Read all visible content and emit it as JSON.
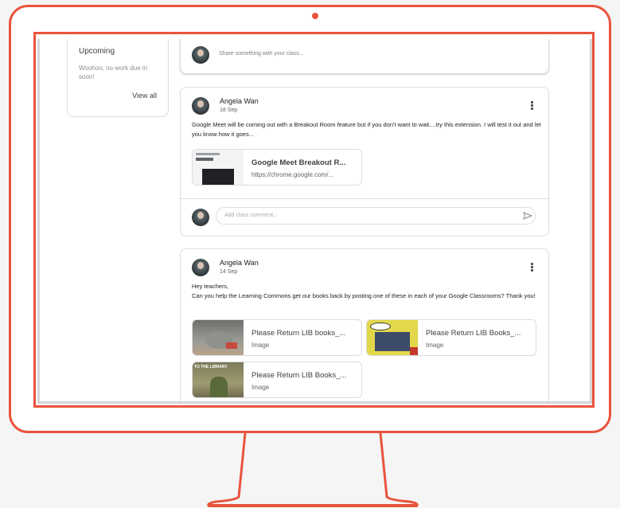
{
  "sidebar": {
    "upcoming": {
      "title": "Upcoming",
      "text": "Woohoo, no work due in soon!",
      "link": "View all"
    }
  },
  "share": {
    "placeholder": "Share something with your class..."
  },
  "posts": [
    {
      "author": "Angela Wan",
      "date": "18 Sep",
      "body": "Google Meet will be coming out with a Breakout Room feature but if you don't want to wait....try this extension. I will test it out and let you know how it goes...",
      "attachments": [
        {
          "title": "Google Meet Breakout R...",
          "subtitle": "https://chrome.google.com/..."
        }
      ],
      "comment_placeholder": "Add class comment..."
    },
    {
      "author": "Angela Wan",
      "date": "14 Sep",
      "body_line1": "Hey teachers,",
      "body_line2": "Can you help the Learning Commons get our books back by posting one of these in each of your Google Classrooms? Thank you!",
      "attachments": [
        {
          "title": "Please Return LIB books_...",
          "subtitle": "Image"
        },
        {
          "title": "Please Return LIB Books_...",
          "subtitle": "Image"
        },
        {
          "title": "Please Return LIB Books_...",
          "subtitle": "Image"
        }
      ],
      "thumb_captions": [
        "TO THE LIBRARY"
      ]
    }
  ],
  "colors": {
    "monitor": "#e9533d",
    "border": "#dadce0"
  },
  "icons": [
    "kebab-menu-icon",
    "send-icon",
    "avatar"
  ]
}
